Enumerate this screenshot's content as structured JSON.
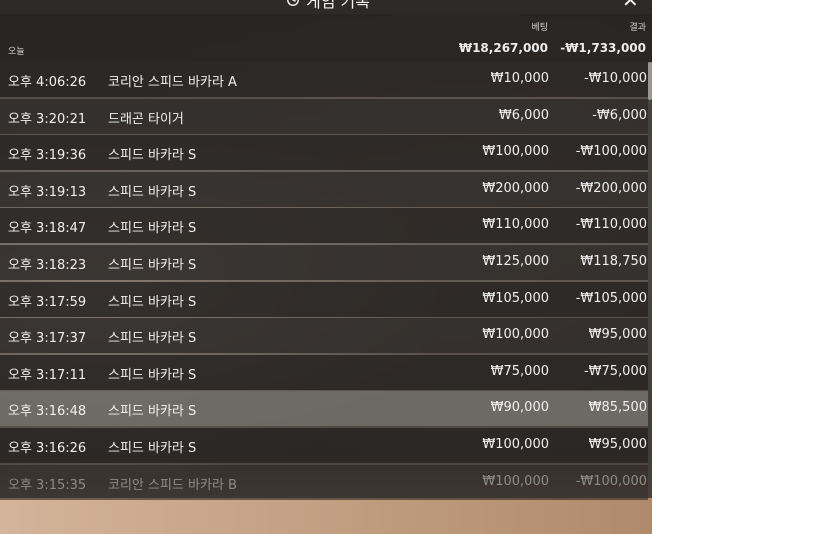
{
  "header": {
    "title": "게임 기록",
    "close_glyph": "✕",
    "bet_label": "베팅",
    "result_label": "결과",
    "today_label": "오늘",
    "bet_total": "₩18,267,000",
    "result_total": "-₩1,733,000"
  },
  "rows": [
    {
      "time": "오후 4:06:26",
      "game": "코리안 스피드 바카라 A",
      "bet": "₩10,000",
      "result": "-₩10,000"
    },
    {
      "time": "오후 3:20:21",
      "game": "드래곤 타이거",
      "bet": "₩6,000",
      "result": "-₩6,000"
    },
    {
      "time": "오후 3:19:36",
      "game": "스피드 바카라 S",
      "bet": "₩100,000",
      "result": "-₩100,000"
    },
    {
      "time": "오후 3:19:13",
      "game": "스피드 바카라 S",
      "bet": "₩200,000",
      "result": "-₩200,000"
    },
    {
      "time": "오후 3:18:47",
      "game": "스피드 바카라 S",
      "bet": "₩110,000",
      "result": "-₩110,000"
    },
    {
      "time": "오후 3:18:23",
      "game": "스피드 바카라 S",
      "bet": "₩125,000",
      "result": "₩118,750"
    },
    {
      "time": "오후 3:17:59",
      "game": "스피드 바카라 S",
      "bet": "₩105,000",
      "result": "-₩105,000"
    },
    {
      "time": "오후 3:17:37",
      "game": "스피드 바카라 S",
      "bet": "₩100,000",
      "result": "₩95,000"
    },
    {
      "time": "오후 3:17:11",
      "game": "스피드 바카라 S",
      "bet": "₩75,000",
      "result": "-₩75,000"
    },
    {
      "time": "오후 3:16:48",
      "game": "스피드 바카라 S",
      "bet": "₩90,000",
      "result": "₩85,500"
    },
    {
      "time": "오후 3:16:26",
      "game": "스피드 바카라 S",
      "bet": "₩100,000",
      "result": "₩95,000"
    },
    {
      "time": "오후 3:15:35",
      "game": "코리안 스피드 바카라 B",
      "bet": "₩100,000",
      "result": "-₩100,000"
    }
  ],
  "selected_row": 9,
  "icons": {
    "title": "history-icon",
    "close": "close-icon"
  }
}
